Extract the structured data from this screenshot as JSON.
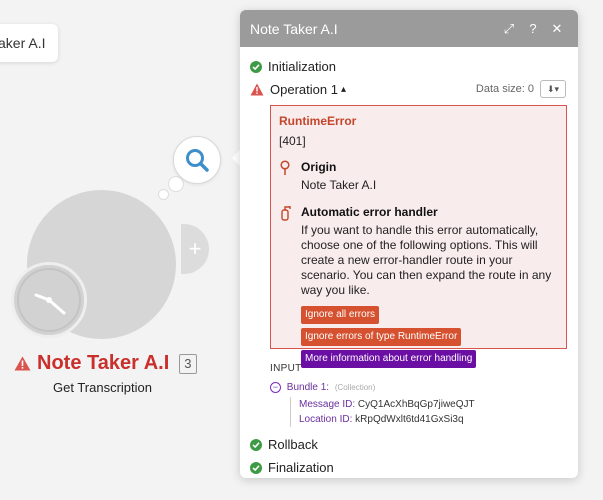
{
  "canvas": {
    "top_chip_label": "aker A.I",
    "module": {
      "title": "Note Taker A.I",
      "count": "3",
      "subtitle": "Get Transcription"
    }
  },
  "panel": {
    "title": "Note Taker A.I",
    "header_icons": [
      "expand-icon",
      "help-icon",
      "close-icon"
    ],
    "header_glyphs": {
      "expand": "⤢",
      "help": "?",
      "close": "✕"
    },
    "initialization": "Initialization",
    "operation": "Operation 1",
    "operation_caret": "▴",
    "data_size_label": "Data size: 0",
    "download_glyph": "⬇▾",
    "error": {
      "title": "RuntimeError",
      "code": "[401]",
      "origin_heading": "Origin",
      "origin_value": "Note Taker A.I",
      "handler_heading": "Automatic error handler",
      "handler_text": "If you want to handle this error automatically, choose one of the following options. This will create a new error-handler route in your scenario. You can then expand the route in any way you like.",
      "actions": [
        "Ignore all errors",
        "Ignore errors of type RuntimeError",
        "More information about error handling"
      ]
    },
    "input": {
      "title": "INPUT",
      "bundle_label": "Bundle 1:",
      "bundle_type": "(Collection)",
      "fields": [
        {
          "key": "Message ID:",
          "value": "CyQ1AcXhBqGp7jiweQJT"
        },
        {
          "key": "Location ID:",
          "value": "kRpQdWxlt6td41GxSi3q"
        }
      ]
    },
    "rollback": "Rollback",
    "finalization": "Finalization"
  },
  "colors": {
    "success": "#3e9b45",
    "error": "#d9534f",
    "action_red": "#d5512f",
    "action_purple": "#6b0ea4",
    "header_grey": "#9b9b9b"
  }
}
